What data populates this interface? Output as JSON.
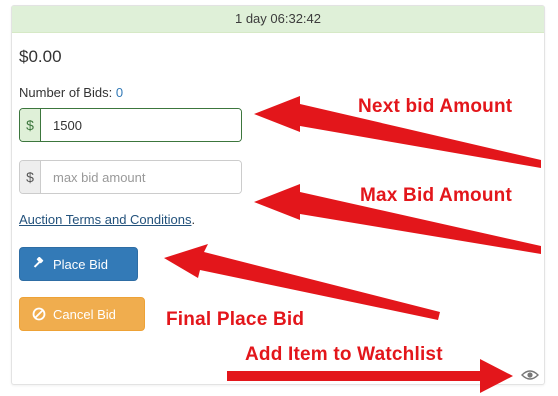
{
  "auction": {
    "time_remaining": "1 day 06:32:42",
    "current_price": "$0.00",
    "bids_label": "Number of Bids:",
    "bids_count": "0"
  },
  "bid_input": {
    "currency": "$",
    "value": "1500"
  },
  "max_bid_input": {
    "currency": "$",
    "placeholder": "max bid amount"
  },
  "terms": {
    "link_text": "Auction Terms and Conditions",
    "suffix": "."
  },
  "buttons": {
    "place_bid": "Place Bid",
    "cancel_bid": "Cancel Bid"
  },
  "icons": {
    "place_bid": "gavel-icon",
    "cancel_bid": "ban-icon",
    "watchlist": "eye-icon"
  },
  "annotations": {
    "next_bid": "Next bid Amount",
    "max_bid": "Max Bid Amount",
    "final_place": "Final Place Bid",
    "watchlist": "Add Item to Watchlist"
  },
  "colors": {
    "annotation_red": "#e3161b",
    "primary": "#337ab7",
    "warning": "#f0ad4e",
    "success_bg": "#dff0d8"
  }
}
